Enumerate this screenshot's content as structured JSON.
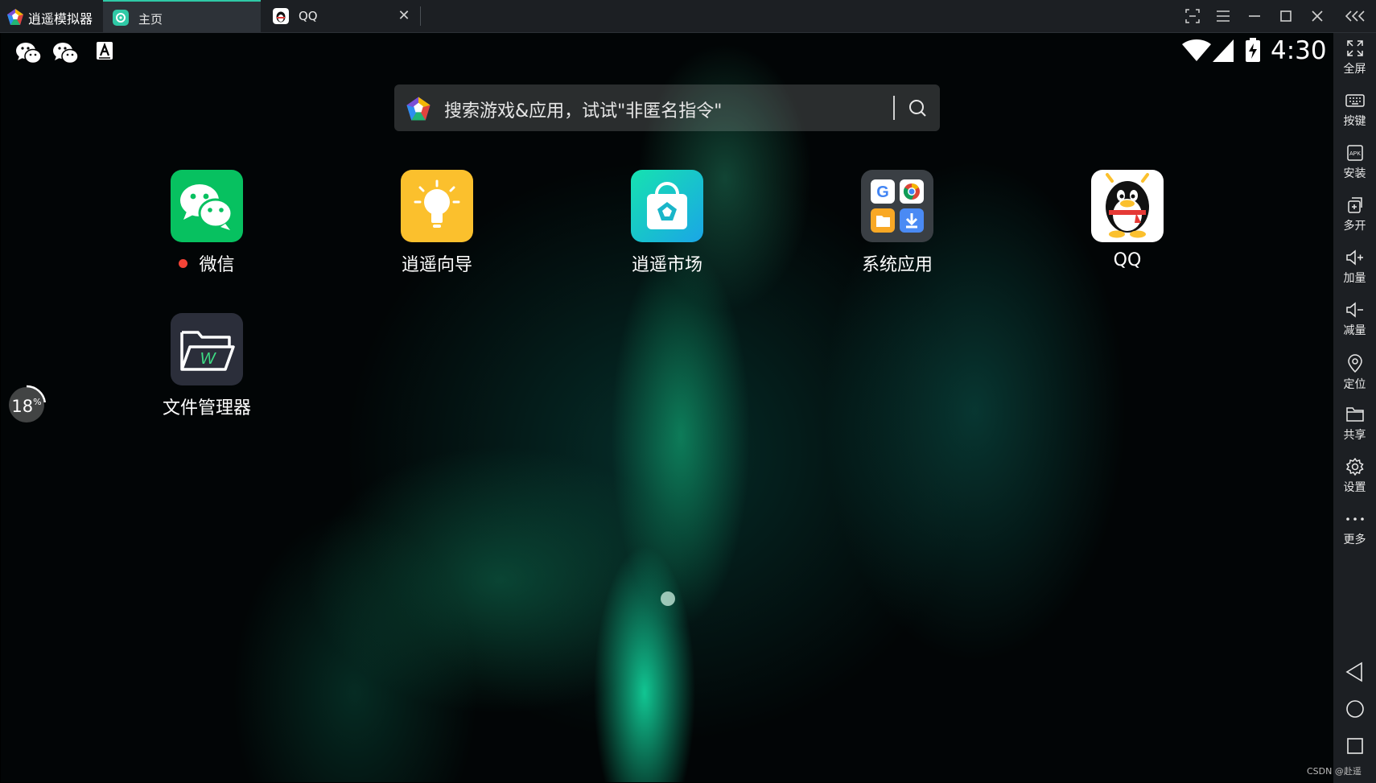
{
  "titlebar": {
    "app_name": "逍遥模拟器",
    "tabs": [
      {
        "label": "主页",
        "icon": "home-tab-icon",
        "active": true
      },
      {
        "label": "QQ",
        "icon": "qq-tab-icon",
        "active": false
      }
    ],
    "controls": [
      "screenshot-icon",
      "menu-icon",
      "minimize-icon",
      "maximize-icon",
      "close-icon",
      "collapse-sidebar-icon"
    ]
  },
  "statusbar": {
    "left_icons": [
      "wechat-notification-icon",
      "wechat-notification-icon",
      "keyboard-a-icon"
    ],
    "right_icons": [
      "wifi-icon",
      "cellular-signal-icon",
      "battery-charging-icon"
    ],
    "time": "4:30"
  },
  "search": {
    "placeholder": "搜索游戏&应用，试试\"非匿名指令\""
  },
  "apps": [
    {
      "label": "微信",
      "icon": "wechat-icon",
      "notification": true
    },
    {
      "label": "逍遥向导",
      "icon": "lightbulb-icon",
      "notification": false
    },
    {
      "label": "逍遥市场",
      "icon": "market-bag-icon",
      "notification": false
    },
    {
      "label": "系统应用",
      "icon": "system-apps-folder-icon",
      "notification": false
    },
    {
      "label": "QQ",
      "icon": "qq-penguin-icon",
      "notification": false
    },
    {
      "label": "文件管理器",
      "icon": "file-manager-icon",
      "notification": false
    }
  ],
  "memory_widget": {
    "value": "18",
    "unit": "%",
    "progress": 0.18
  },
  "sidebar": {
    "items": [
      {
        "label": "全屏",
        "icon": "fullscreen-icon"
      },
      {
        "label": "按键",
        "icon": "keyboard-icon"
      },
      {
        "label": "安装",
        "icon": "apk-install-icon"
      },
      {
        "label": "多开",
        "icon": "multi-instance-icon"
      },
      {
        "label": "加量",
        "icon": "volume-up-icon"
      },
      {
        "label": "减量",
        "icon": "volume-down-icon"
      },
      {
        "label": "定位",
        "icon": "location-icon"
      },
      {
        "label": "共享",
        "icon": "shared-folder-icon"
      },
      {
        "label": "设置",
        "icon": "settings-gear-icon"
      },
      {
        "label": "更多",
        "icon": "more-dots-icon"
      }
    ],
    "nav": [
      "back-icon",
      "home-icon",
      "recents-icon"
    ]
  },
  "watermark": "CSDN @赴遥",
  "colors": {
    "accent": "#2fc9a6",
    "wechat_green": "#07c160",
    "bar_bg": "#1c1f23",
    "notif_red": "#f44336"
  }
}
